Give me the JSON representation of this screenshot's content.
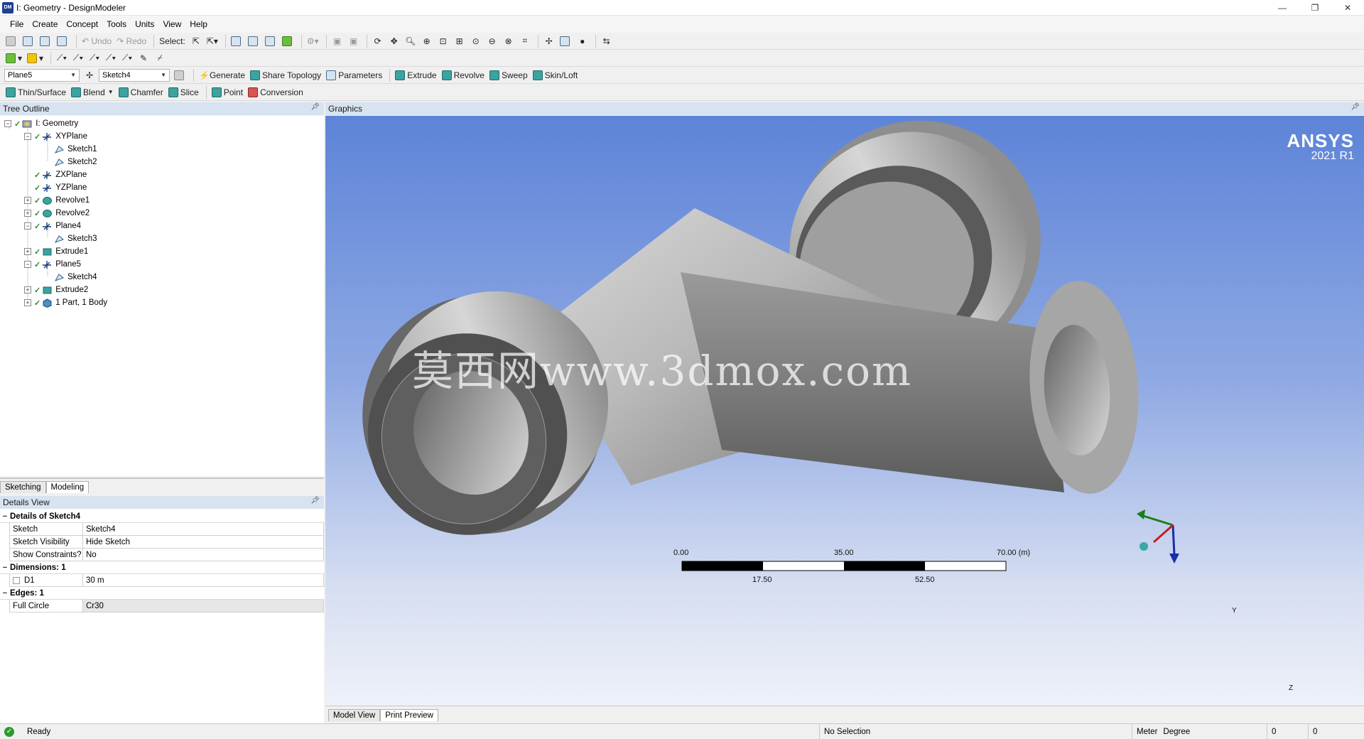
{
  "window": {
    "app_icon": "DM",
    "title": "I: Geometry - DesignModeler",
    "controls": [
      "—",
      "❐",
      "✕"
    ]
  },
  "menu": [
    "File",
    "Create",
    "Concept",
    "Tools",
    "Units",
    "View",
    "Help"
  ],
  "toolbar1": {
    "undo": "Undo",
    "redo": "Redo",
    "select_label": "Select:"
  },
  "toolbar3": {
    "plane_combo": "Plane5",
    "sketch_combo": "Sketch4",
    "generate": "Generate",
    "share_topology": "Share Topology",
    "parameters": "Parameters",
    "extrude": "Extrude",
    "revolve": "Revolve",
    "sweep": "Sweep",
    "skin_loft": "Skin/Loft"
  },
  "toolbar4": {
    "thin_surface": "Thin/Surface",
    "blend": "Blend",
    "chamfer": "Chamfer",
    "slice": "Slice",
    "point": "Point",
    "conversion": "Conversion"
  },
  "tree": {
    "header": "Tree Outline",
    "items": [
      {
        "label": "I: Geometry",
        "icon": "geometry-icon"
      },
      {
        "label": "XYPlane",
        "icon": "plane-icon"
      },
      {
        "label": "Sketch1",
        "icon": "sketch-icon"
      },
      {
        "label": "Sketch2",
        "icon": "sketch-icon"
      },
      {
        "label": "ZXPlane",
        "icon": "plane-icon"
      },
      {
        "label": "YZPlane",
        "icon": "plane-icon"
      },
      {
        "label": "Revolve1",
        "icon": "revolve-icon"
      },
      {
        "label": "Revolve2",
        "icon": "revolve-icon"
      },
      {
        "label": "Plane4",
        "icon": "plane-icon"
      },
      {
        "label": "Sketch3",
        "icon": "sketch-icon"
      },
      {
        "label": "Extrude1",
        "icon": "extrude-icon"
      },
      {
        "label": "Plane5",
        "icon": "plane-icon"
      },
      {
        "label": "Sketch4",
        "icon": "sketch-icon"
      },
      {
        "label": "Extrude2",
        "icon": "extrude-icon"
      },
      {
        "label": "1 Part, 1 Body",
        "icon": "body-icon"
      }
    ]
  },
  "mode_tabs": [
    "Sketching",
    "Modeling"
  ],
  "details": {
    "header": "Details View",
    "title": "Details of Sketch4",
    "rows": [
      {
        "key": "Sketch",
        "value": "Sketch4"
      },
      {
        "key": "Sketch Visibility",
        "value": "Hide Sketch"
      },
      {
        "key": "Show Constraints?",
        "value": "No"
      }
    ],
    "dimensions_title": "Dimensions: 1",
    "dimension_rows": [
      {
        "key": "D1",
        "value": "30 m"
      }
    ],
    "edges_title": "Edges: 1",
    "edge_rows": [
      {
        "key": "Full Circle",
        "value": "Cr30"
      }
    ]
  },
  "graphics": {
    "header": "Graphics",
    "logo_name": "ANSYS",
    "logo_version": "2021 R1",
    "watermark": "莫西网www.3dmox.com",
    "scale_top": [
      "0.00",
      "35.00",
      "70.00 (m)"
    ],
    "scale_bottom": [
      "17.50",
      "52.50"
    ],
    "axes": {
      "y": "Y",
      "z": "Z"
    }
  },
  "view_tabs": [
    "Model View",
    "Print Preview"
  ],
  "status": {
    "ready": "Ready",
    "selection": "No Selection",
    "units_length": "Meter",
    "units_angle": "Degree",
    "field1": "0",
    "field2": "0"
  },
  "colors": {
    "accent": "#1f3f8f",
    "panel_header": "#d7e3f0",
    "viewport_top": "#5d84d8",
    "viewport_bottom": "#eef1f8",
    "check_green": "#2e8b2e"
  }
}
